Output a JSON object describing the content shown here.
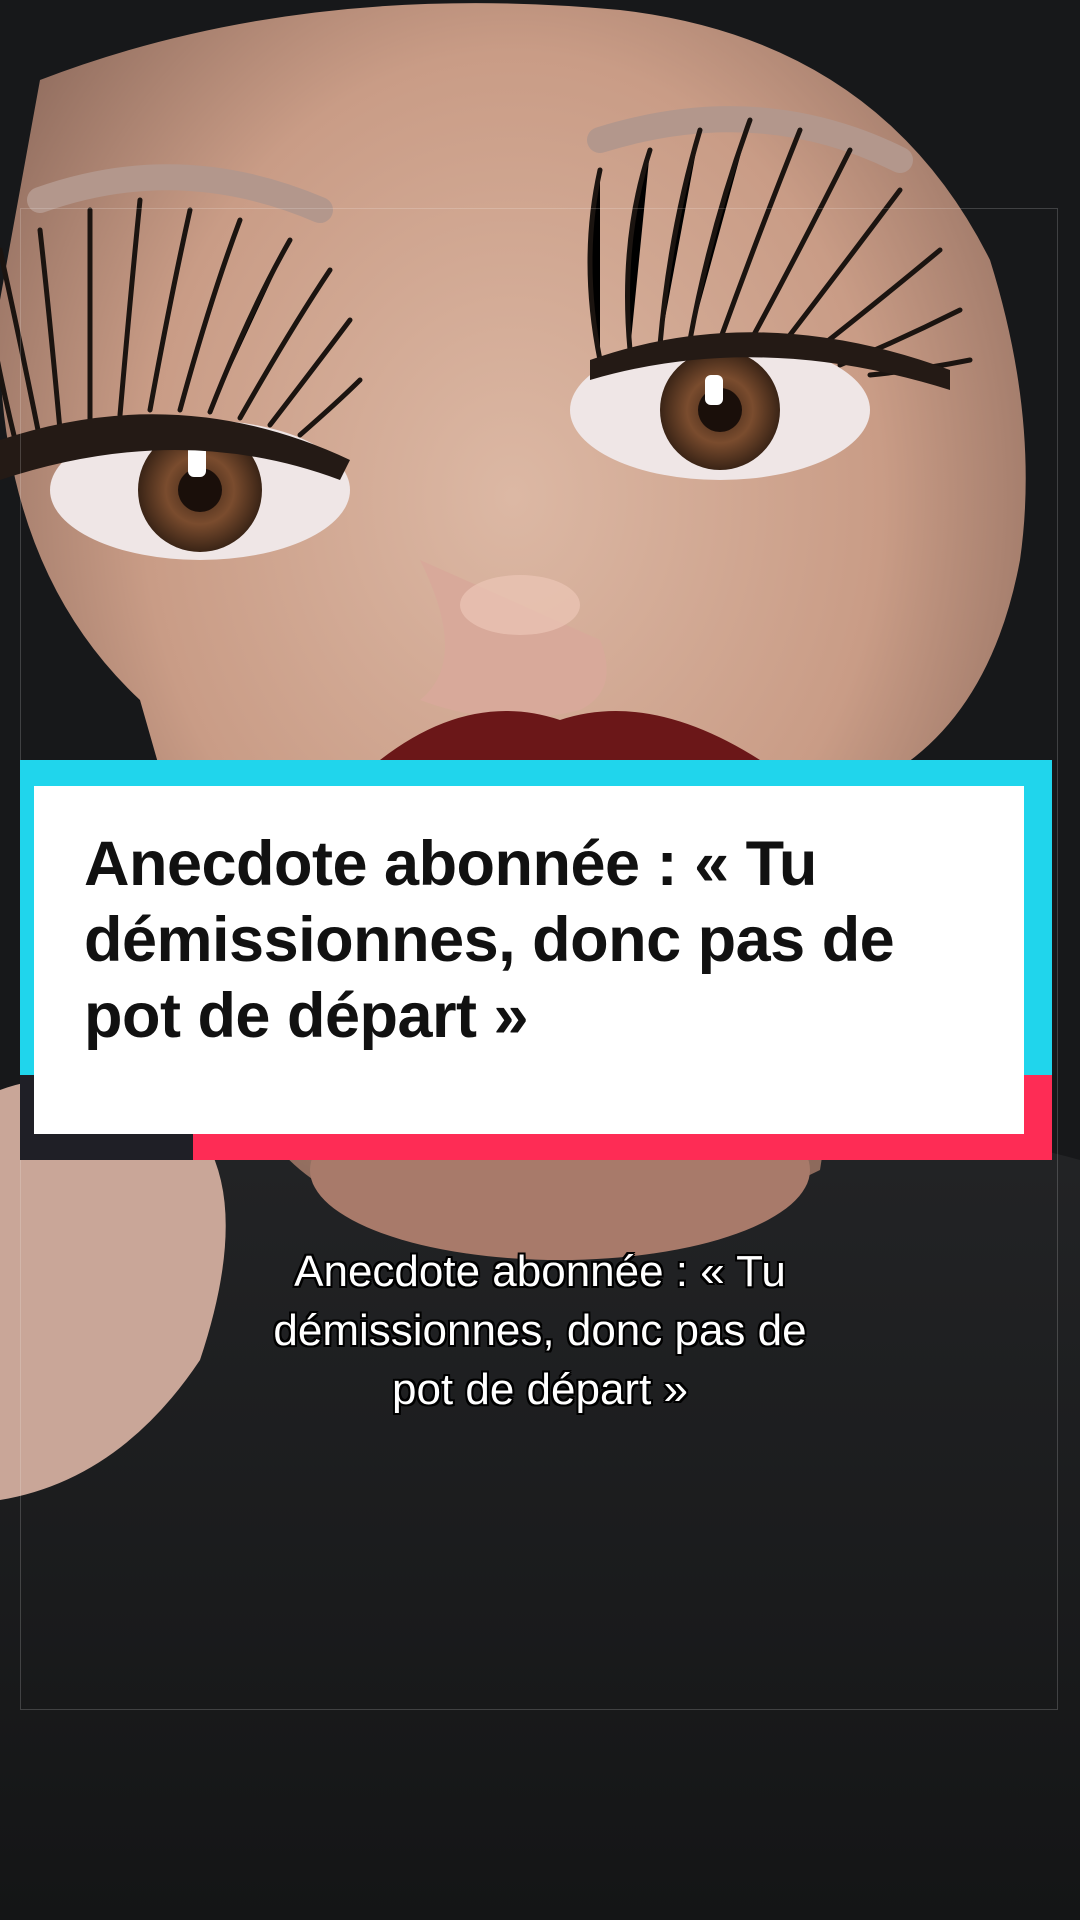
{
  "video": {
    "title_card": {
      "lines": [
        "Anecdote abonnée : « Tu",
        "démissionnes, donc pas de",
        "pot de départ »"
      ],
      "colors": {
        "frame_cyan": "#20d5ec",
        "frame_red": "#fe2c55",
        "frame_dark": "#1f1f26",
        "card_bg": "#ffffff",
        "text": "#111111"
      }
    },
    "caption": {
      "lines": [
        "Anecdote abonnée : « Tu",
        "démissionnes, donc pas de",
        "pot de départ »"
      ]
    }
  }
}
